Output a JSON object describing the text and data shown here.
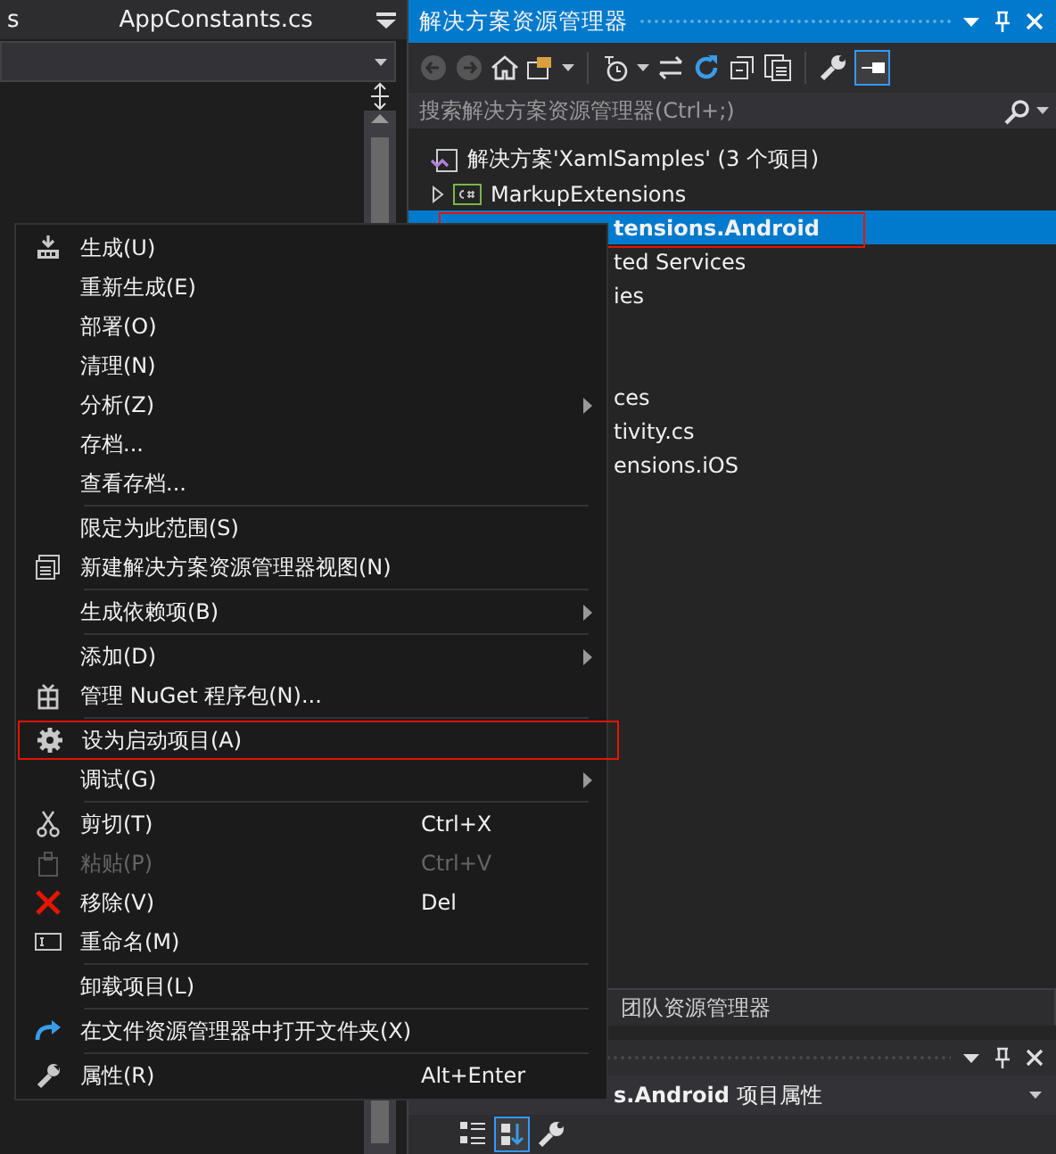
{
  "editor": {
    "tabs": [
      {
        "label": "s"
      },
      {
        "label": "AppConstants.cs"
      }
    ]
  },
  "solution_explorer": {
    "title": "解决方案资源管理器",
    "search": {
      "placeholder": "搜索解决方案资源管理器(Ctrl+;)"
    },
    "tree": [
      {
        "kind": "solution",
        "text": "解决方案'XamlSamples' (3 个项目)",
        "selected": false
      },
      {
        "kind": "project",
        "text": "MarkupExtensions",
        "selected": false
      },
      {
        "kind": "fragment",
        "text": "tensions.Android",
        "selected": true
      },
      {
        "kind": "fragment",
        "text": "ted Services",
        "selected": false
      },
      {
        "kind": "fragment",
        "text": "ies",
        "selected": false
      },
      {
        "kind": "fragment",
        "text": "ces",
        "selected": false
      },
      {
        "kind": "fragment",
        "text": "tivity.cs",
        "selected": false
      },
      {
        "kind": "fragment",
        "text": "ensions.iOS",
        "selected": false
      }
    ],
    "tabs": [
      {
        "label": "团队资源管理器",
        "selected": false
      }
    ]
  },
  "properties": {
    "title": "**s.Android** 项目属性"
  },
  "context_menu": [
    {
      "kind": "item",
      "label": "生成(U)",
      "submenu": false,
      "disabled": false,
      "outlined": false
    },
    {
      "kind": "item",
      "label": "重新生成(E)",
      "submenu": false,
      "disabled": false,
      "outlined": false
    },
    {
      "kind": "item",
      "label": "部署(O)",
      "submenu": false,
      "disabled": false,
      "outlined": false
    },
    {
      "kind": "item",
      "label": "清理(N)",
      "submenu": false,
      "disabled": false,
      "outlined": false
    },
    {
      "kind": "item",
      "label": "分析(Z)",
      "submenu": true,
      "disabled": false,
      "outlined": false
    },
    {
      "kind": "item",
      "label": "存档...",
      "submenu": false,
      "disabled": false,
      "outlined": false
    },
    {
      "kind": "item",
      "label": "查看存档...",
      "submenu": false,
      "disabled": false,
      "outlined": false
    },
    {
      "kind": "separator"
    },
    {
      "kind": "item",
      "label": "限定为此范围(S)",
      "submenu": false,
      "disabled": false,
      "outlined": false
    },
    {
      "kind": "item",
      "label": "新建解决方案资源管理器视图(N)",
      "submenu": false,
      "disabled": false,
      "outlined": false
    },
    {
      "kind": "separator"
    },
    {
      "kind": "item",
      "label": "生成依赖项(B)",
      "submenu": true,
      "disabled": false,
      "outlined": false
    },
    {
      "kind": "separator"
    },
    {
      "kind": "item",
      "label": "添加(D)",
      "submenu": true,
      "disabled": false,
      "outlined": false
    },
    {
      "kind": "item",
      "label": "管理 NuGet 程序包(N)...",
      "submenu": false,
      "disabled": false,
      "outlined": false
    },
    {
      "kind": "separator"
    },
    {
      "kind": "item",
      "label": "设为启动项目(A)",
      "submenu": false,
      "disabled": false,
      "outlined": true
    },
    {
      "kind": "item",
      "label": "调试(G)",
      "submenu": true,
      "disabled": false,
      "outlined": false
    },
    {
      "kind": "separator"
    },
    {
      "kind": "item",
      "label": "剪切(T)",
      "shortcut": "Ctrl+X",
      "submenu": false,
      "disabled": false,
      "outlined": false
    },
    {
      "kind": "item",
      "label": "粘贴(P)",
      "shortcut": "Ctrl+V",
      "submenu": false,
      "disabled": true,
      "outlined": false
    },
    {
      "kind": "item",
      "label": "移除(V)",
      "shortcut": "Del",
      "submenu": false,
      "disabled": false,
      "outlined": false
    },
    {
      "kind": "item",
      "label": "重命名(M)",
      "submenu": false,
      "disabled": false,
      "outlined": false
    },
    {
      "kind": "separator"
    },
    {
      "kind": "item",
      "label": "卸载项目(L)",
      "submenu": false,
      "disabled": false,
      "outlined": false
    },
    {
      "kind": "separator"
    },
    {
      "kind": "item",
      "label": "在文件资源管理器中打开文件夹(X)",
      "submenu": false,
      "disabled": false,
      "outlined": false
    },
    {
      "kind": "separator"
    },
    {
      "kind": "item",
      "label": "属性(R)",
      "shortcut": "Alt+Enter",
      "submenu": false,
      "disabled": false,
      "outlined": false
    }
  ]
}
